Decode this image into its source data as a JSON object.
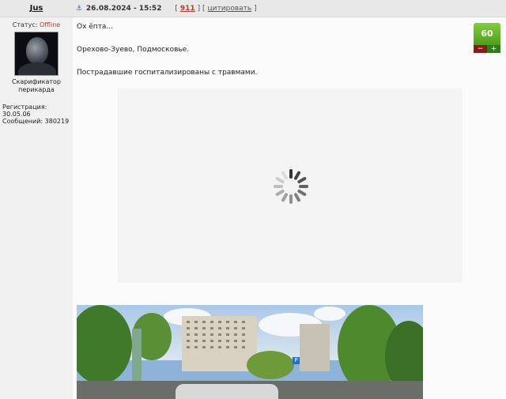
{
  "user": {
    "name": "Jus",
    "status_label": "Статус:",
    "status_value": "Offline",
    "rank_line1": "Скарификатор",
    "rank_line2": "перикарда",
    "registered": "Регистрация: 30.05.06",
    "messages": "Сообщений: 380219"
  },
  "post": {
    "date": "26.08.2024 - 15:52",
    "id": "911",
    "quote_label": "цитировать",
    "lines": [
      "Ох ёпта...",
      "Орехово-Зуево, Подмосковье.",
      "Пострадавшие госпитализированы с травмами."
    ]
  },
  "rating": {
    "value": "60",
    "minus": "−",
    "plus": "+"
  },
  "icons": {
    "anchor": "anchor-icon",
    "spinner": "loading-spinner-icon"
  },
  "colors": {
    "offline": "#c0392b",
    "rating_bg": "#5fb027",
    "post_id": "#c0392b"
  }
}
